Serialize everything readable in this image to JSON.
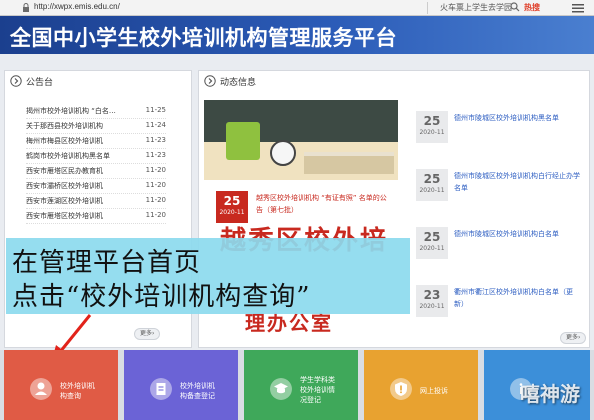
{
  "browser": {
    "url": "http://xwpx.emis.edu.cn/",
    "search_hint": "火车票上学生去学园",
    "hot_label": "热搜"
  },
  "header": {
    "title": "全国中小学生校外培训机构管理服务平台"
  },
  "notices": {
    "heading": "公告台",
    "items": [
      {
        "title": "揭州市校外培训机构 “白名…",
        "date": "11-25"
      },
      {
        "title": "关于那西县校外培训机构",
        "date": "11-24"
      },
      {
        "title": "梅州市梅县区校外培训机",
        "date": "11-23"
      },
      {
        "title": "鹤岗市校外培训机构黑名单",
        "date": "11-23"
      },
      {
        "title": "西安市雁塔区民办教育机",
        "date": "11-20"
      },
      {
        "title": "西安市灞桥区校外培训机",
        "date": "11-20"
      },
      {
        "title": "西安市莲湖区校外培训机",
        "date": "11-20"
      },
      {
        "title": "西安市雁塔区校外培训机",
        "date": "11-20"
      }
    ],
    "more_label": "更多›"
  },
  "news": {
    "heading": "动态信息",
    "featured": {
      "day": "25",
      "ym": "2020-11",
      "title": "越秀区校外培训机构 “有证有照” 名单的公告（第七批）"
    },
    "items": [
      {
        "day": "25",
        "ym": "2020-11",
        "title": "德州市陵城区校外培训机构黑名单"
      },
      {
        "day": "25",
        "ym": "2020-11",
        "title": "德州市陵城区校外培训机构白行经止办学名单"
      },
      {
        "day": "25",
        "ym": "2020-11",
        "title": "德州市陵城区校外培训机构白名单"
      },
      {
        "day": "23",
        "ym": "2020-11",
        "title": "衢州市衢江区校外培训机构白名单（更新）"
      }
    ],
    "big_text_1": "越秀区校外培",
    "big_text_2": "理办公室",
    "more_label": "更多›"
  },
  "caption": {
    "line1": "在管理平台首页",
    "line2": "点击“校外培训机构查询”"
  },
  "tiles": [
    {
      "label": "校外培训机\n构查询",
      "color": "#e05b45",
      "icon": "user-search-icon"
    },
    {
      "label": "校外培训机\n构备查登记",
      "color": "#6b63d6",
      "icon": "document-icon"
    },
    {
      "label": "学生学科类\n校外培训情\n况登记",
      "color": "#3fa85a",
      "icon": "student-icon"
    },
    {
      "label": "网上投诉",
      "color": "#e8a230",
      "icon": "shield-icon"
    },
    {
      "label": "",
      "color": "#3c8fd9",
      "icon": "info-icon"
    }
  ],
  "watermark": "嘻神游"
}
